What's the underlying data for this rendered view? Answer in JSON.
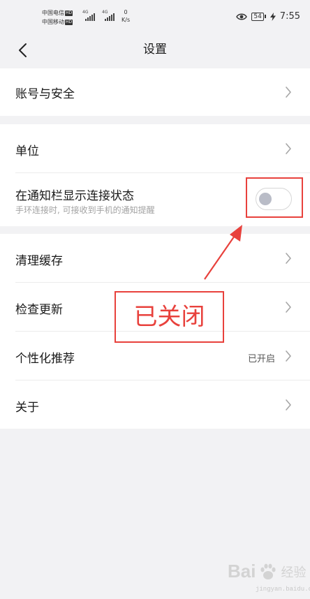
{
  "status_bar": {
    "carrier_1": "中国电信",
    "carrier_2": "中国移动",
    "hd_badge": "HD",
    "signal_type": "4G",
    "net_speed_value": "0",
    "net_speed_unit": "K/s",
    "battery": "54",
    "time": "7:55"
  },
  "header": {
    "title": "设置"
  },
  "settings": {
    "account": {
      "label": "账号与安全"
    },
    "unit": {
      "label": "单位"
    },
    "notification": {
      "label": "在通知栏显示连接状态",
      "description": "手环连接时, 可接收到手机的通知提醒",
      "enabled": false
    },
    "clear_cache": {
      "label": "清理缓存"
    },
    "check_update": {
      "label": "检查更新"
    },
    "personalized": {
      "label": "个性化推荐",
      "value": "已开启"
    },
    "about": {
      "label": "关于"
    }
  },
  "annotation": {
    "text": "已关闭",
    "color": "#e8413c"
  },
  "watermark": {
    "brand": "Bai",
    "brand_tail": "经验",
    "url": "jingyan.baidu.com"
  },
  "colors": {
    "background": "#f2f2f4",
    "card": "#ffffff",
    "toggle_off_knob": "#b9bcc7",
    "annotation": "#e8413c"
  }
}
